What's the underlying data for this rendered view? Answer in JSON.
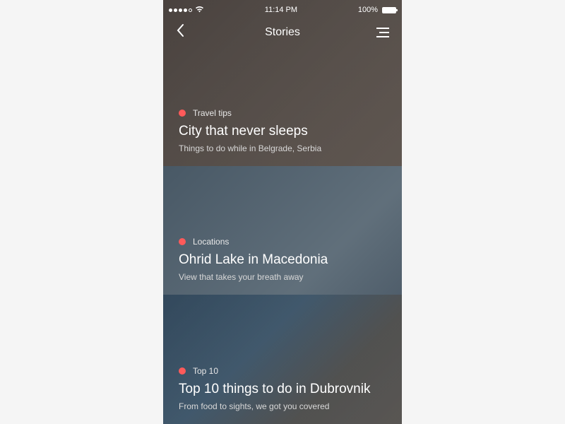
{
  "status_bar": {
    "time": "11:14 PM",
    "battery_percent": "100%",
    "wifi_icon": "wifi"
  },
  "header": {
    "title": "Stories"
  },
  "stories": [
    {
      "category": "Travel tips",
      "title": "City that never sleeps",
      "subtitle": "Things to do while in Belgrade, Serbia"
    },
    {
      "category": "Locations",
      "title": "Ohrid Lake in Macedonia",
      "subtitle": "View that takes your breath away"
    },
    {
      "category": "Top 10",
      "title": "Top 10 things to do in Dubrovnik",
      "subtitle": "From food to sights, we got you covered"
    }
  ],
  "colors": {
    "accent_dot": "#ff5a5a"
  }
}
